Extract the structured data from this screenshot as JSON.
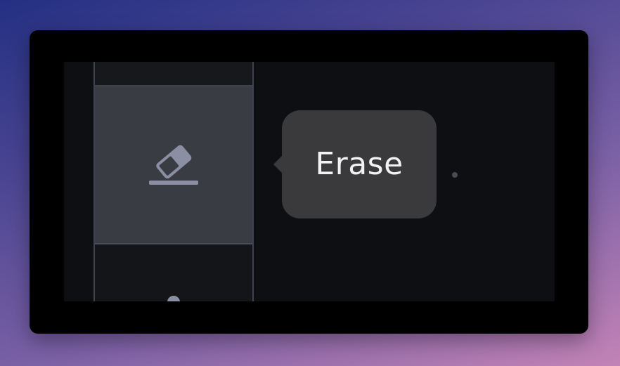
{
  "tooltip": {
    "text": "Erase"
  },
  "toolbar": {
    "active_tool_icon": "eraser-icon",
    "partial_tool_icon": "tool-icon"
  },
  "colors": {
    "active_tool_bg": "#3a3c43",
    "tooltip_bg": "#3a3a3c",
    "icon": "#8a8fa3",
    "canvas_bg": "#0e0f13"
  }
}
